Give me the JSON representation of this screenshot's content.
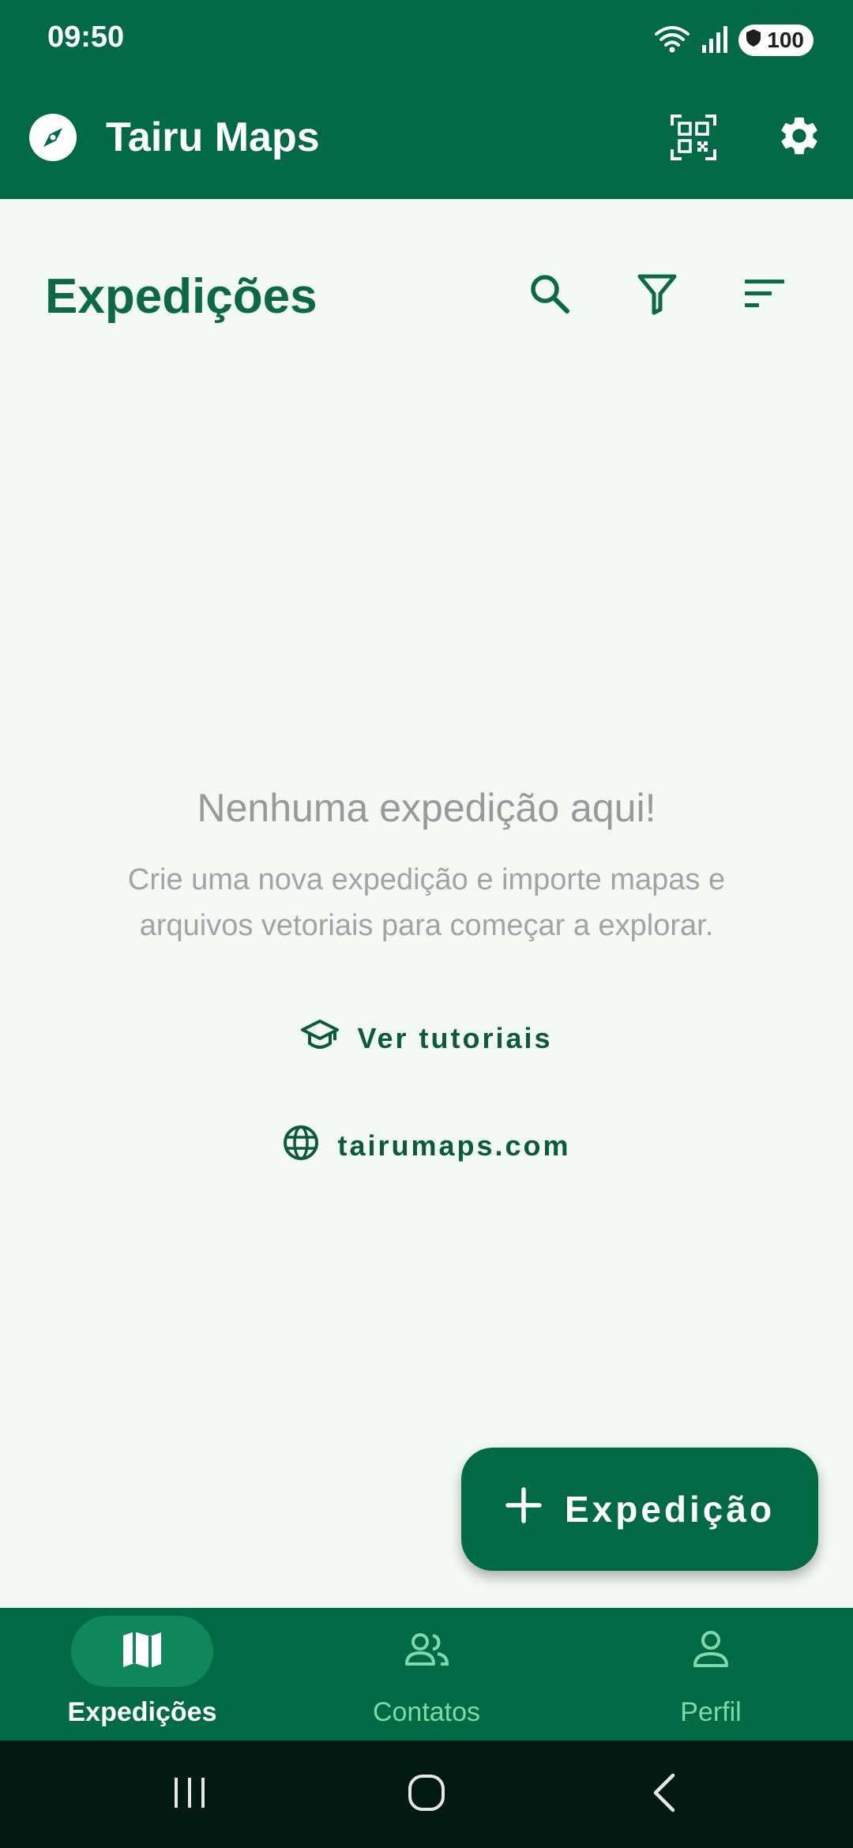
{
  "status_bar": {
    "time": "09:50",
    "battery": "100",
    "icons": [
      "wifi-icon",
      "signal-icon",
      "battery-icon"
    ]
  },
  "app_bar": {
    "title": "Tairu Maps",
    "icons": [
      "compass-logo-icon",
      "qr-code-icon",
      "gear-icon"
    ]
  },
  "page": {
    "title": "Expedições",
    "actions": [
      "search-icon",
      "filter-icon",
      "sort-icon"
    ]
  },
  "empty_state": {
    "title": "Nenhuma expedição aqui!",
    "description_line1": "Crie uma nova expedição e importe mapas e",
    "description_line2": "arquivos vetoriais para começar a explorar.",
    "tutorial_label": "Ver tutoriais",
    "site_label": "tairumaps.com"
  },
  "fab": {
    "label": "Expedição",
    "icon": "plus-icon"
  },
  "bottom_nav": {
    "items": [
      {
        "label": "Expedições",
        "icon": "map-icon",
        "active": true
      },
      {
        "label": "Contatos",
        "icon": "people-icon",
        "active": false
      },
      {
        "label": "Perfil",
        "icon": "person-icon",
        "active": false
      }
    ]
  },
  "colors": {
    "primary": "#006a44",
    "background": "#f3f9f3",
    "nav_active_pill": "#10875a",
    "nav_inactive_label": "#7fd8a9",
    "empty_text": "#999999"
  }
}
